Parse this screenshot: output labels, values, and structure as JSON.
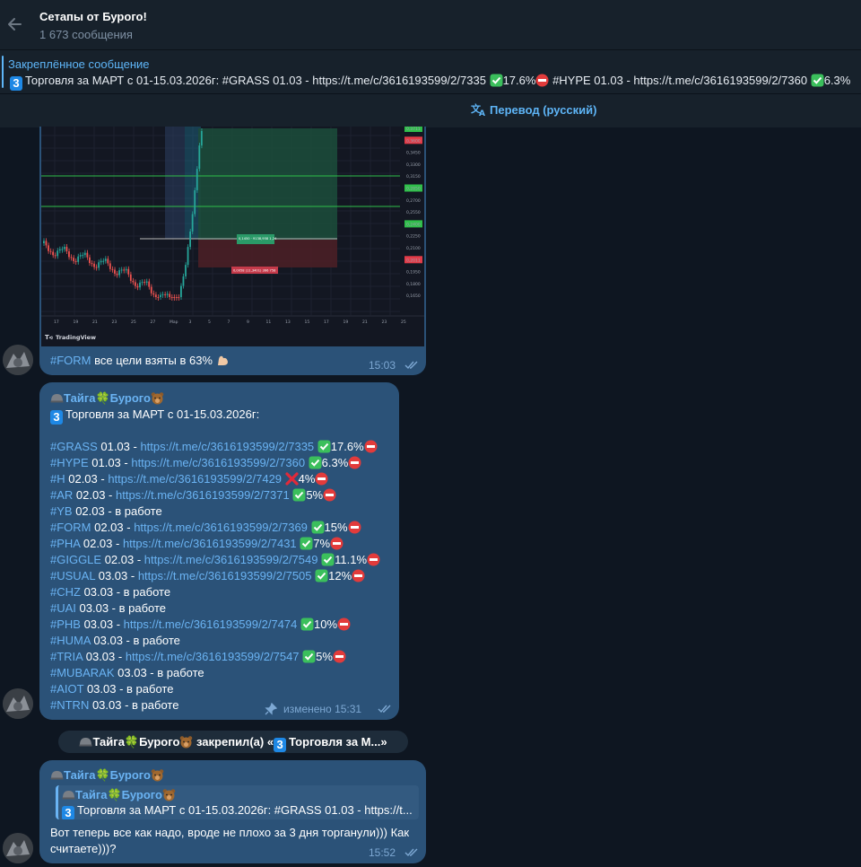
{
  "header": {
    "title": "Сетапы от Бурого!",
    "subtitle": "1 673 сообщения"
  },
  "pinned": {
    "title": "Закреплённое сообщение",
    "text": "Торговля за МАРТ с 01-15.03.2026г:  #GRASS 01.03 - https://t.me/c/3616193599/2/7335",
    "text_2": "17.6%",
    "text_3": "#HYPE 01.03 - https://t.me/c/3616193599/2/7360",
    "text_4": "6.3%"
  },
  "translate": {
    "label": "Перевод (русский)"
  },
  "chart_msg": {
    "tradingview": "TradingView",
    "caption_tag": "#FORM",
    "caption_text": " все цели взяты в 63%",
    "time": "15:03",
    "price_labels": [
      "0,3711",
      "0,3600",
      "0,3450",
      "0,3300",
      "0,3150",
      "0,2850",
      "0,2700",
      "0,2550",
      "0,2400",
      "0,2250",
      "0,2100",
      "0,2011",
      "0,1950",
      "0,1800",
      "0,1650"
    ],
    "x_labels": [
      "17",
      "19",
      "21",
      "23",
      "25",
      "27",
      "Мар",
      "3",
      "5",
      "7",
      "9",
      "11",
      "13",
      "15",
      "17",
      "19",
      "21",
      "23",
      "25"
    ],
    "box_label_green": "0,1450 · 9138,958  1,24",
    "box_label_red": "0,0058 (11,3401) 366 758"
  },
  "trade_msg": {
    "sender": "Тайга🍀Бурого",
    "heading": "Торговля за МАРТ с 01-15.03.2026г:",
    "rows": [
      {
        "tag": "#GRASS",
        "date": " 01.03 - ",
        "link": "https://t.me/c/3616193599/2/7335",
        "mark": "check",
        "pct": "17.6%",
        "stop": true
      },
      {
        "tag": "#HYPE",
        "date": " 01.03 - ",
        "link": "https://t.me/c/3616193599/2/7360",
        "mark": "check",
        "pct": "6.3%",
        "stop": true
      },
      {
        "tag": "#H",
        "date": " 02.03 - ",
        "link": "https://t.me/c/3616193599/2/7429",
        "mark": "cross",
        "pct": "4%",
        "stop": true
      },
      {
        "tag": "#AR",
        "date": " 02.03 - ",
        "link": "https://t.me/c/3616193599/2/7371",
        "mark": "check",
        "pct": "5%",
        "stop": true
      },
      {
        "tag": "#YB",
        "date": " 02.03 - в работе",
        "link": "",
        "mark": "",
        "pct": "",
        "stop": false
      },
      {
        "tag": "#FORM",
        "date": " 02.03 - ",
        "link": "https://t.me/c/3616193599/2/7369",
        "mark": "check",
        "pct": "15%",
        "stop": true
      },
      {
        "tag": "#PHA",
        "date": " 02.03 - ",
        "link": "https://t.me/c/3616193599/2/7431",
        "mark": "check",
        "pct": "7%",
        "stop": true
      },
      {
        "tag": "#GIGGLE",
        "date": " 02.03 - ",
        "link": "https://t.me/c/3616193599/2/7549",
        "mark": "check",
        "pct": "11.1%",
        "stop": true
      },
      {
        "tag": "#USUAL",
        "date": " 03.03 - ",
        "link": "https://t.me/c/3616193599/2/7505",
        "mark": "check",
        "pct": "12%",
        "stop": true
      },
      {
        "tag": "#CHZ",
        "date": " 03.03 - в работе",
        "link": "",
        "mark": "",
        "pct": "",
        "stop": false
      },
      {
        "tag": "#UAI",
        "date": " 03.03 - в работе",
        "link": "",
        "mark": "",
        "pct": "",
        "stop": false
      },
      {
        "tag": "#PHB",
        "date": " 03.03 - ",
        "link": "https://t.me/c/3616193599/2/7474",
        "mark": "check",
        "pct": "10%",
        "stop": true
      },
      {
        "tag": "#HUMA",
        "date": " 03.03 - в работе",
        "link": "",
        "mark": "",
        "pct": "",
        "stop": false
      },
      {
        "tag": "#TRIA",
        "date": " 03.03 - ",
        "link": "https://t.me/c/3616193599/2/7547",
        "mark": "check",
        "pct": "5%",
        "stop": true
      },
      {
        "tag": "#MUBARAK",
        "date": " 03.03 - в работе",
        "link": "",
        "mark": "",
        "pct": "",
        "stop": false
      },
      {
        "tag": "#AIOT",
        "date": " 03.03 - в работе",
        "link": "",
        "mark": "",
        "pct": "",
        "stop": false
      },
      {
        "tag": "#NTRN",
        "date": " 03.03 - в работе",
        "link": "",
        "mark": "",
        "pct": "",
        "stop": false
      }
    ],
    "edited": "изменено 15:31"
  },
  "service": {
    "text": "Тайга🍀Бурого",
    "text_2": " закрепил(а) «",
    "text_3": "Торговля за М...»"
  },
  "reply_msg": {
    "sender": "Тайга🍀Бурого",
    "reply_name": "Тайга🍀Бурого",
    "reply_text": "Торговля за МАРТ с 01-15.03.2026г:  #GRASS 01.03 - https://t...",
    "text": "Вот теперь все как надо, вроде не плохо за 3 дня торганули))) Как считаете)))?",
    "time": "15:52"
  }
}
